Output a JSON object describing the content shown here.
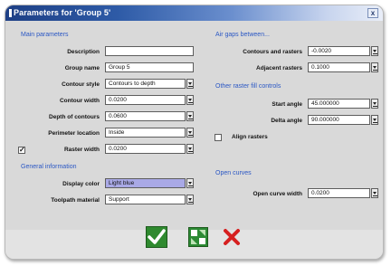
{
  "window": {
    "title": "Parameters for 'Group 5'",
    "close_label": "x"
  },
  "main": {
    "heading": "Main parameters",
    "description": {
      "label": "Description",
      "value": ""
    },
    "group_name": {
      "label": "Group name",
      "value": "Group 5"
    },
    "contour_style": {
      "label": "Contour style",
      "value": "Contours to depth"
    },
    "contour_width": {
      "label": "Contour width",
      "value": "0.0200"
    },
    "depth_of_contours": {
      "label": "Depth of contours",
      "value": "0.0600"
    },
    "perimeter_location": {
      "label": "Perimeter location",
      "value": "Inside"
    },
    "raster_width": {
      "label": "Raster width",
      "value": "0.0200",
      "checked": true,
      "check_mark": "✓"
    }
  },
  "general": {
    "heading": "General information",
    "display_color": {
      "label": "Display color",
      "value": "Light blue"
    },
    "toolpath_material": {
      "label": "Toolpath material",
      "value": "Support"
    }
  },
  "air_gaps": {
    "heading": "Air gaps between...",
    "contours_and_rasters": {
      "label": "Contours and rasters",
      "value": "-0.0020"
    },
    "adjacent_rasters": {
      "label": "Adjacent rasters",
      "value": "0.1000"
    }
  },
  "raster_fill": {
    "heading": "Other raster fill controls",
    "start_angle": {
      "label": "Start angle",
      "value": "45.000000"
    },
    "delta_angle": {
      "label": "Delta angle",
      "value": "90.000000"
    },
    "align_rasters": {
      "label": "Align rasters",
      "checked": false
    }
  },
  "open_curves": {
    "heading": "Open curves",
    "open_curve_width": {
      "label": "Open curve width",
      "value": "0.0200"
    }
  },
  "buttons": {
    "ok": "ok",
    "preview": "preview",
    "cancel": "cancel"
  },
  "colors": {
    "title_start": "#1d3f85",
    "section_heading": "#2a57c4",
    "highlight_field": "#a9a9e6",
    "ok_green": "#2f8a2f",
    "cancel_red": "#d62020"
  }
}
